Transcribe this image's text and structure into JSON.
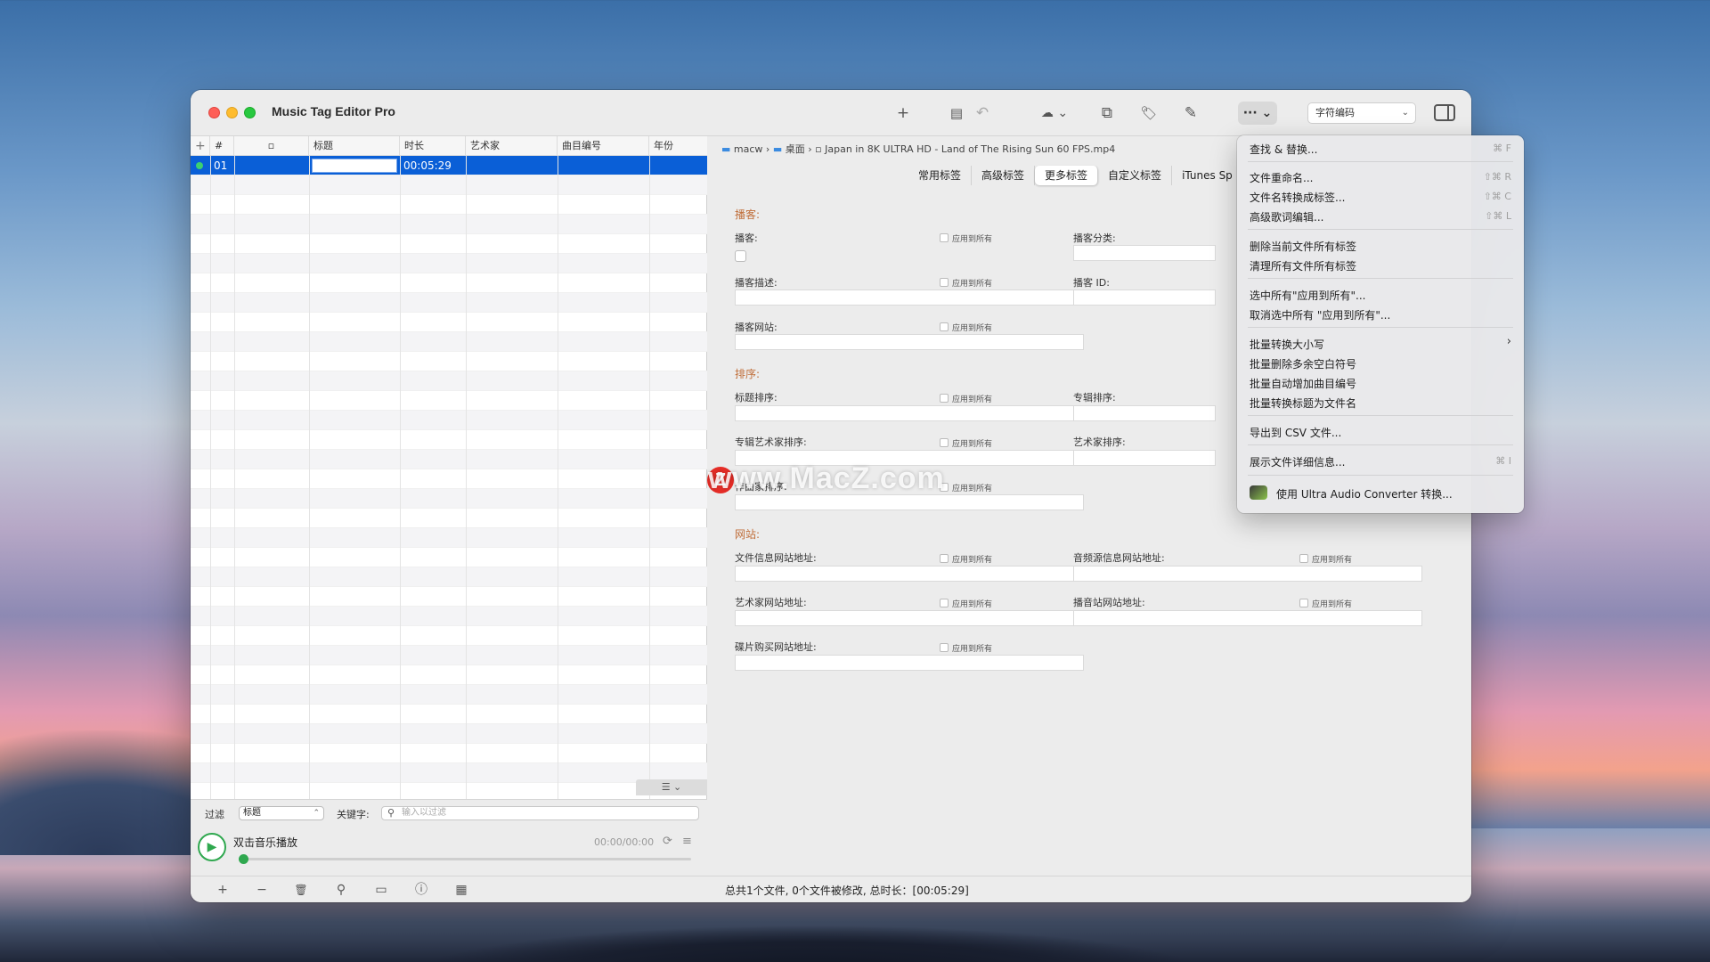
{
  "app": {
    "title": "Music Tag Editor Pro"
  },
  "toolbar": {
    "add": "+",
    "save": "▤",
    "undo": "↶",
    "cloud": "☁ ⌄",
    "convert": "⧉",
    "tag": "🏷",
    "edit": "✎",
    "more": "··· ⌄",
    "encoding": "字符编码",
    "encoding_chev": "⌄"
  },
  "table": {
    "columns": [
      "+",
      "#",
      "▫",
      "标题",
      "时长",
      "艺术家",
      "曲目编号",
      "年份"
    ],
    "rows": [
      {
        "num": "01",
        "title": "",
        "duration": "00:05:29",
        "artist": "",
        "track": "",
        "year": ""
      }
    ]
  },
  "filter": {
    "label": "过滤",
    "field": "标题",
    "keyword_label": "关键字:",
    "placeholder": "输入以过滤"
  },
  "player": {
    "label": "双击音乐播放",
    "time": "00:00/00:00",
    "play": "▶"
  },
  "breadcrumb": {
    "root": "macw",
    "desktop": "桌面",
    "file": "Japan in 8K ULTRA HD - Land of The Rising Sun 60 FPS.mp4",
    "sep": "›"
  },
  "tabs": [
    "常用标签",
    "高级标签",
    "更多标签",
    "自定义标签",
    "iTunes Sp"
  ],
  "form": {
    "apply_all": "应用到所有",
    "sections": {
      "podcast": "播客:",
      "sort": "排序:",
      "web": "网站:"
    },
    "labels": {
      "podcast": "播客:",
      "podcast_category": "播客分类:",
      "podcast_desc": "播客描述:",
      "podcast_id": "播客 ID:",
      "podcast_url": "播客网站:",
      "title_sort": "标题排序:",
      "album_sort": "专辑排序:",
      "album_artist_sort": "专辑艺术家排序:",
      "artist_sort": "艺术家排序:",
      "composer_sort": "作曲家排序:",
      "file_info_url": "文件信息网站地址:",
      "audio_source_url": "音频源信息网站地址:",
      "artist_url": "艺术家网站地址:",
      "radio_url": "播音站网站地址:",
      "purchase_url": "碟片购买网站地址:"
    }
  },
  "menu": {
    "find_replace": "查找 & 替换...",
    "find_replace_sc": "⌘ F",
    "rename": "文件重命名...",
    "rename_sc": "⇧⌘ R",
    "fn_to_tag": "文件名转换成标签...",
    "fn_to_tag_sc": "⇧⌘ C",
    "lyrics": "高级歌词编辑...",
    "lyrics_sc": "⇧⌘ L",
    "del_current": "删除当前文件所有标签",
    "clear_all": "清理所有文件所有标签",
    "select_apply": "选中所有\"应用到所有\"...",
    "deselect_apply": "取消选中所有 \"应用到所有\"...",
    "case": "批量转换大小写",
    "case_arrow": "›",
    "trim": "批量删除多余空白符号",
    "track_inc": "批量自动增加曲目编号",
    "title_to_fn": "批量转换标题为文件名",
    "export_csv": "导出到 CSV 文件...",
    "details": "展示文件详细信息...",
    "details_sc": "⌘ I",
    "converter": "使用 Ultra Audio Converter 转换..."
  },
  "status": {
    "text": "总共1个文件, 0个文件被修改, 总时长：[00:05:29]"
  },
  "bottom": {
    "add": "+",
    "remove": "−",
    "trash": "🗑",
    "search": "⚲",
    "folder": "▭",
    "info": "ⓘ",
    "grid": "▦"
  },
  "watermark": {
    "z": "Z",
    "text": "www.MacZ.com"
  }
}
